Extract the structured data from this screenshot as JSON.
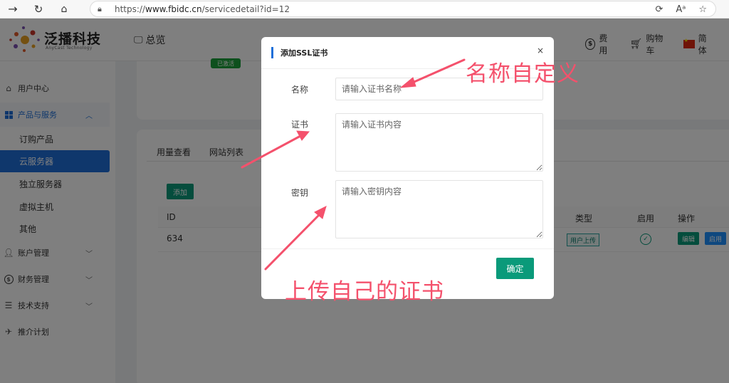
{
  "browser": {
    "url_prefix": "https://",
    "url_host": "www.fbidc.cn",
    "url_path": "/servicedetail?id=12",
    "reader_label": "Aᵃ"
  },
  "header": {
    "logo_text": "泛播科技",
    "logo_sub": "AnyCast Technology",
    "overview": "总览",
    "fee": "费用",
    "cart": "购物车",
    "lang": "简体"
  },
  "sidebar": {
    "user_center": "用户中心",
    "products": "产品与服务",
    "sub_items": [
      "订购产品",
      "云服务器",
      "独立服务器",
      "虚拟主机",
      "其他"
    ],
    "account": "账户管理",
    "finance": "财务管理",
    "support": "技术支持",
    "promote": "推介计划"
  },
  "content": {
    "status_badge": "已激活",
    "tabs": [
      "用量查看",
      "网站列表"
    ],
    "add_button": "添加",
    "table_headers": {
      "id": "ID",
      "type": "类型",
      "enable": "启用",
      "action": "操作"
    },
    "row": {
      "id": "634",
      "type": "用户上传",
      "edit": "编辑",
      "enable": "启用"
    }
  },
  "modal": {
    "title": "添加SSL证书",
    "close": "×",
    "name_label": "名称",
    "name_placeholder": "请输入证书名称",
    "cert_label": "证书",
    "cert_placeholder": "请输入证书内容",
    "key_label": "密钥",
    "key_placeholder": "请输入密钥内容",
    "confirm": "确定"
  },
  "annotations": {
    "top": "名称自定义",
    "bottom": "上传自己的证书",
    "color": "#f4516c"
  }
}
